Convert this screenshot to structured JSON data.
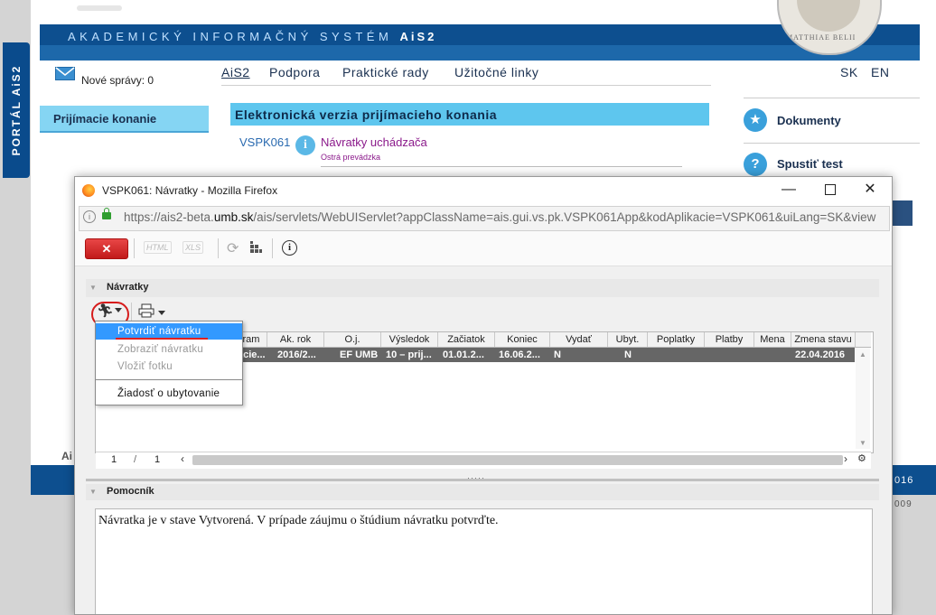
{
  "portal": {
    "side_tab": "PORTÁL AiS2",
    "banner_text": "AKADEMICKÝ INFORMAČNÝ SYSTÉM",
    "banner_ais": "AiS2",
    "seal_text": "MATTHIAE BELII",
    "messages": "Nové správy: 0",
    "nav": [
      "AiS2",
      "Podpora",
      "Praktické rady",
      "Užitočné linky"
    ],
    "lang": [
      "SK",
      "EN"
    ],
    "left_menu": "Prijímacie konanie",
    "main_header": "Elektronická verzia prijímacieho konania",
    "app_code": "VSPK061",
    "app_title": "Návratky uchádzača",
    "app_env": "Ostrá prevádzka",
    "right_links": [
      "Dokumenty",
      "Spustiť test"
    ],
    "footer_left": "Ai",
    "footer_year": "016",
    "footer_year2": "009"
  },
  "window": {
    "title": "VSPK061: Návratky - Mozilla Firefox",
    "min": "—",
    "close": "✕",
    "url_prefix": "https://ais2-beta.",
    "url_host": "umb.sk",
    "url_rest": "/ais/servlets/WebUIServlet?appClassName=ais.gui.vs.pk.VSPK061App&kodAplikacie=VSPK061&uiLang=SK&view"
  },
  "toolbar": {
    "close_label": "✕",
    "html_label": "HTML",
    "xls_label": "XLS",
    "refresh": "⟳",
    "info": "i"
  },
  "navratky": {
    "title": "Návratky",
    "columns": [
      "ram",
      "Ak. rok",
      "O.j.",
      "Výsledok",
      "Začiatok",
      "Koniec",
      "Vydať",
      "Ubyt.",
      "Poplatky",
      "Platby",
      "Mena",
      "Zmena stavu"
    ],
    "row": [
      "acie...",
      "2016/2...",
      "EF UMB",
      "10 – prij...",
      "01.01.2...",
      "16.06.2...",
      "N",
      "N",
      "",
      "",
      "",
      "22.04.2016"
    ],
    "page_current": "1",
    "page_sep": "/",
    "page_total": "1"
  },
  "menu": {
    "items": [
      "Potvrdiť návratku",
      "Zobraziť návratku",
      "Vložiť fotku",
      "Žiadosť o ubytovanie"
    ]
  },
  "pomocnik": {
    "title": "Pomocník",
    "text": "Návratka je v stave Vytvorená. V prípade záujmu o štúdium návratku potvrďte."
  }
}
